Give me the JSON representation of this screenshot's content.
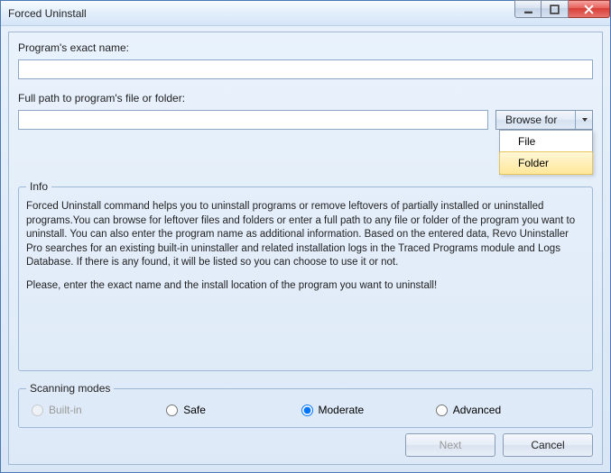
{
  "window": {
    "title": "Forced Uninstall"
  },
  "fields": {
    "name_label": "Program's exact name:",
    "name_value": "",
    "path_label": "Full path to program's file or folder:",
    "path_value": ""
  },
  "browse": {
    "label": "Browse for",
    "menu": {
      "file": "File",
      "folder": "Folder"
    }
  },
  "info": {
    "legend": "Info",
    "p1": "Forced Uninstall command helps you to uninstall programs or remove leftovers of partially installed or uninstalled programs.You can browse for leftover files and folders or enter a full path to any file or folder of the program you want to uninstall. You can also enter the program name as additional information. Based on the entered data, Revo Uninstaller Pro searches for an existing built-in uninstaller and related installation logs in the Traced Programs module and Logs Database. If there is any found, it will be listed so you can choose to use it or not.",
    "p2": "Please, enter the exact name and the install location of the program you want to uninstall!"
  },
  "modes": {
    "legend": "Scanning modes",
    "builtin": "Built-in",
    "safe": "Safe",
    "moderate": "Moderate",
    "advanced": "Advanced"
  },
  "footer": {
    "next": "Next",
    "cancel": "Cancel"
  }
}
